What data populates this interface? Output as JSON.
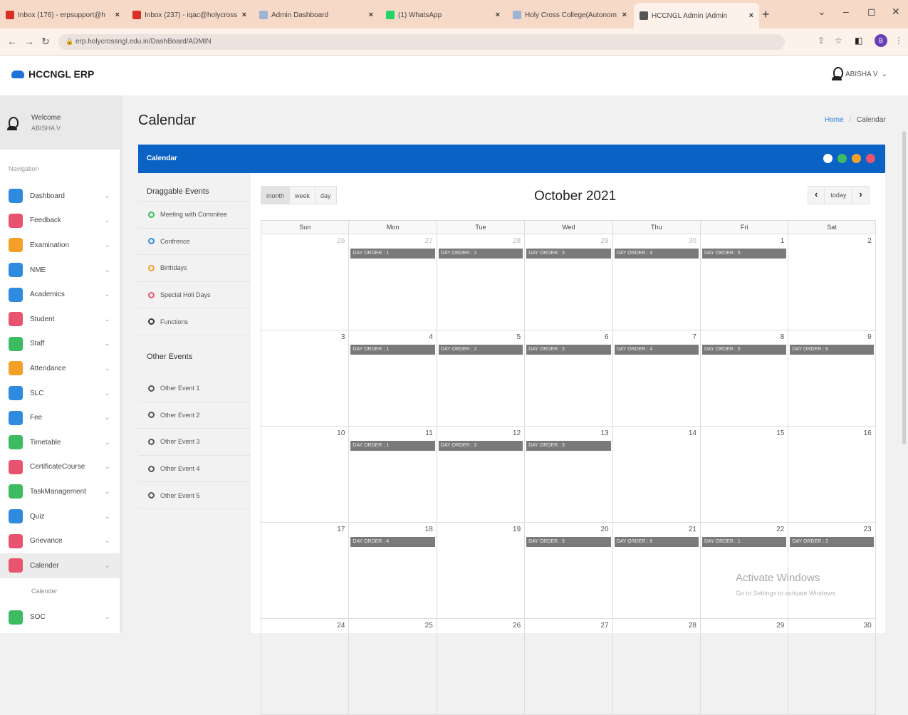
{
  "browser": {
    "tabs": [
      {
        "label": "Inbox (176) - erpsupport@h",
        "color": "#d93025",
        "icon": "gmail-icon"
      },
      {
        "label": "Inbox (237) - iqac@holycross",
        "color": "#d93025",
        "icon": "gmail-icon"
      },
      {
        "label": "Admin Dashboard",
        "color": "#9db4d6",
        "icon": "page-icon"
      },
      {
        "label": "(1) WhatsApp",
        "color": "#25d366",
        "icon": "whatsapp-icon"
      },
      {
        "label": "Holy Cross College(Autonom",
        "color": "#9db4d6",
        "icon": "page-icon"
      },
      {
        "label": "HCCNGL Admin |Admin",
        "color": "#555555",
        "icon": "user-icon"
      }
    ],
    "url": "erp.holycrossngl.edu.in/DashBoard/ADMIN",
    "profile_initial": "B"
  },
  "app": {
    "brand": "HCCNGL ERP",
    "user_name": "ABISHA V",
    "welcome": "Welcome",
    "welcome_name": "ABISHA V"
  },
  "sidebar": {
    "heading": "Navigation",
    "items": [
      {
        "label": "Dashboard",
        "color": "#2e8be0"
      },
      {
        "label": "Feedback",
        "color": "#e8546f"
      },
      {
        "label": "Examination",
        "color": "#f3a028"
      },
      {
        "label": "NME",
        "color": "#2e8be0"
      },
      {
        "label": "Academics",
        "color": "#2e8be0"
      },
      {
        "label": "Student",
        "color": "#e8546f"
      },
      {
        "label": "Staff",
        "color": "#3dbb61"
      },
      {
        "label": "Attendance",
        "color": "#f3a028"
      },
      {
        "label": "SLC",
        "color": "#2e8be0"
      },
      {
        "label": "Fee",
        "color": "#2e8be0"
      },
      {
        "label": "Timetable",
        "color": "#3dbb61"
      },
      {
        "label": "CertificateCourse",
        "color": "#e8546f"
      },
      {
        "label": "TaskManagement",
        "color": "#3dbb61"
      },
      {
        "label": "Quiz",
        "color": "#2e8be0"
      },
      {
        "label": "Grievance",
        "color": "#e8546f"
      },
      {
        "label": "Calender",
        "color": "#e8546f"
      }
    ],
    "sub_item": "Calender",
    "last_item": {
      "label": "SOC",
      "color": "#3dbb61"
    }
  },
  "page": {
    "title": "Calendar",
    "breadcrumb_home": "Home",
    "breadcrumb_sep": "/",
    "breadcrumb_current": "Calendar",
    "panel_title": "Calendar",
    "panel_dots": [
      "#ffffff",
      "#3dbb61",
      "#f3a028",
      "#e8546f"
    ]
  },
  "events": {
    "draggable_heading": "Draggable Events",
    "draggable": [
      {
        "label": "Meeting with Commitee",
        "color": "#3dbb61"
      },
      {
        "label": "Confrence",
        "color": "#2e8be0"
      },
      {
        "label": "Birthdays",
        "color": "#f3a028"
      },
      {
        "label": "Special Holi Days",
        "color": "#e8546f"
      },
      {
        "label": "Functions",
        "color": "#333333"
      }
    ],
    "other_heading": "Other Events",
    "other": [
      "Other Event 1",
      "Other Event 2",
      "Other Event 3",
      "Other Event 4",
      "Other Event 5"
    ]
  },
  "calendar": {
    "views": [
      "month",
      "week",
      "day"
    ],
    "active_view": "month",
    "title": "October 2021",
    "today": "today",
    "prev": "‹",
    "next": "›",
    "days_of_week": [
      "Sun",
      "Mon",
      "Tue",
      "Wed",
      "Thu",
      "Fri",
      "Sat"
    ],
    "weeks": [
      [
        {
          "d": "26",
          "o": true
        },
        {
          "d": "27",
          "o": true,
          "e": "DAY ORDER : 1"
        },
        {
          "d": "28",
          "o": true,
          "e": "DAY ORDER : 2"
        },
        {
          "d": "29",
          "o": true,
          "e": "DAY ORDER : 3"
        },
        {
          "d": "30",
          "o": true,
          "e": "DAY ORDER : 4"
        },
        {
          "d": "1",
          "e": "DAY ORDER : 5"
        },
        {
          "d": "2"
        }
      ],
      [
        {
          "d": "3"
        },
        {
          "d": "4",
          "e": "DAY ORDER : 1"
        },
        {
          "d": "5",
          "e": "DAY ORDER : 2"
        },
        {
          "d": "6",
          "e": "DAY ORDER : 3"
        },
        {
          "d": "7",
          "e": "DAY ORDER : 4"
        },
        {
          "d": "8",
          "e": "DAY ORDER : 5"
        },
        {
          "d": "9",
          "e": "DAY ORDER : 6"
        }
      ],
      [
        {
          "d": "10"
        },
        {
          "d": "11",
          "e": "DAY ORDER : 1"
        },
        {
          "d": "12",
          "e": "DAY ORDER : 2"
        },
        {
          "d": "13",
          "e": "DAY ORDER : 3"
        },
        {
          "d": "14"
        },
        {
          "d": "15"
        },
        {
          "d": "16"
        }
      ],
      [
        {
          "d": "17"
        },
        {
          "d": "18",
          "e": "DAY ORDER : 4"
        },
        {
          "d": "19"
        },
        {
          "d": "20",
          "e": "DAY ORDER : 5"
        },
        {
          "d": "21",
          "e": "DAY ORDER : 6"
        },
        {
          "d": "22",
          "e": "DAY ORDER : 1"
        },
        {
          "d": "23",
          "e": "DAY ORDER : 2"
        }
      ],
      [
        {
          "d": "24"
        },
        {
          "d": "25"
        },
        {
          "d": "26"
        },
        {
          "d": "27"
        },
        {
          "d": "28"
        },
        {
          "d": "29"
        },
        {
          "d": "30"
        }
      ]
    ]
  },
  "watermark": {
    "title": "Activate Windows",
    "subtitle": "Go to Settings to activate Windows."
  }
}
